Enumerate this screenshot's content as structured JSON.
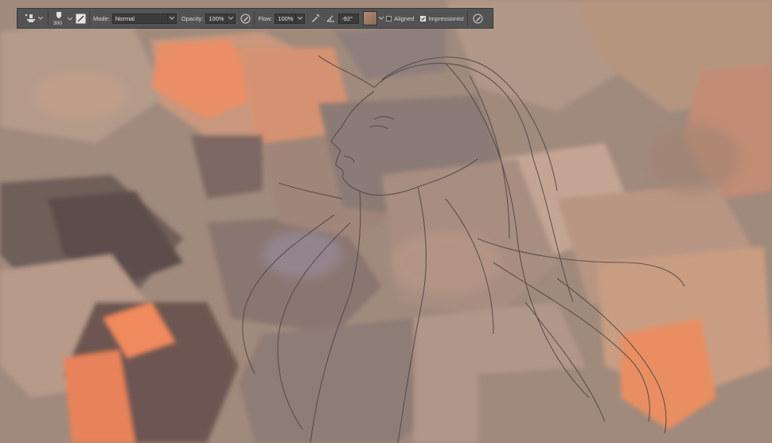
{
  "toolbar": {
    "tool_icon": "art-history-brush-icon",
    "brush_size": "300",
    "mode": {
      "label": "Mode:",
      "value": "Normal"
    },
    "opacity": {
      "label": "Opacity:",
      "value": "100%"
    },
    "flow": {
      "label": "Flow:",
      "value": "100%"
    },
    "angle": {
      "value": "-92°"
    },
    "aligned": {
      "label": "Aligned",
      "checked": false
    },
    "source": {
      "label": "Impressionist",
      "checked": true
    }
  },
  "colors": {
    "toolbar_bg": "#535353",
    "field_bg": "#3b3b3b",
    "canvas_base": "#a08a7c",
    "accent_orange": "#f08a5d",
    "sketch_line": "#4e4646"
  }
}
